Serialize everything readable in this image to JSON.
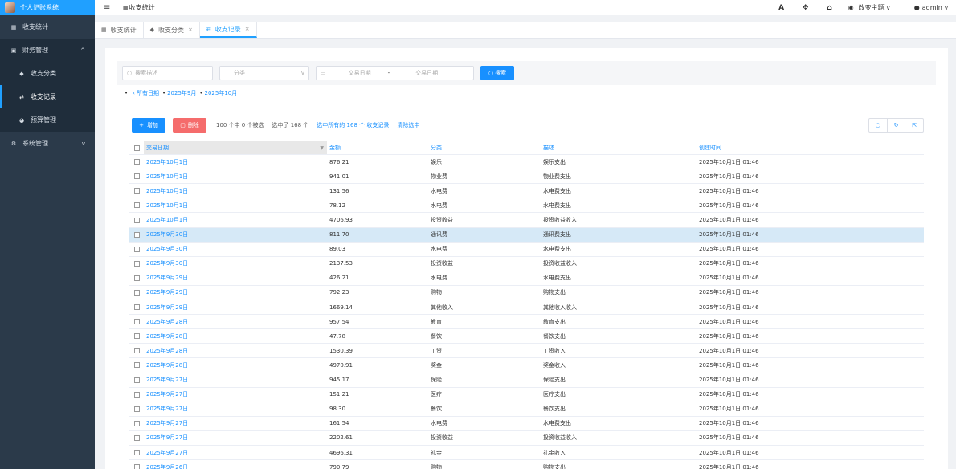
{
  "app": {
    "title": "个人记账系统"
  },
  "sidebar": {
    "items": [
      {
        "label": "收支统计",
        "icon": "grid-icon"
      },
      {
        "label": "财务管理",
        "icon": "wallet-icon",
        "expanded": true
      },
      {
        "label": "收支分类",
        "icon": "tag-icon"
      },
      {
        "label": "收支记录",
        "icon": "exchange-icon",
        "active": true
      },
      {
        "label": "预算管理",
        "icon": "pie-icon"
      },
      {
        "label": "系统管理",
        "icon": "cogs-icon"
      }
    ]
  },
  "header": {
    "breadcrumb": "收支统计",
    "theme_label": "改变主题",
    "user_name": "admin",
    "font_icon_label": "A"
  },
  "tabs": [
    {
      "label": "收支统计"
    },
    {
      "label": "收支分类"
    },
    {
      "label": "收支记录",
      "active": true
    }
  ],
  "filter": {
    "search_placeholder": "搜索描述",
    "category_placeholder": "分类",
    "date_start_placeholder": "交易日期",
    "date_sep": "-",
    "date_end_placeholder": "交易日期",
    "search_button": "搜索"
  },
  "date_crumb": {
    "all": "所有日期",
    "month": "2025年9月",
    "month2": "2025年10月"
  },
  "toolbar": {
    "add_button": "增加",
    "delete_button": "删除",
    "selection_info": "100 个中 0 个被选",
    "selected_count": "选中了 168 个",
    "select_all_link": "选中所有的 168 个 收支记录",
    "clear_link": "清除选中"
  },
  "table": {
    "headers": [
      "交易日期",
      "金额",
      "分类",
      "描述",
      "创建时间"
    ],
    "rows": [
      [
        "2025年10月1日",
        "876.21",
        "娱乐",
        "娱乐支出",
        "2025年10月1日 01:46"
      ],
      [
        "2025年10月1日",
        "941.01",
        "物业费",
        "物业费支出",
        "2025年10月1日 01:46"
      ],
      [
        "2025年10月1日",
        "131.56",
        "水电费",
        "水电费支出",
        "2025年10月1日 01:46"
      ],
      [
        "2025年10月1日",
        "78.12",
        "水电费",
        "水电费支出",
        "2025年10月1日 01:46"
      ],
      [
        "2025年10月1日",
        "4706.93",
        "投资收益",
        "投资收益收入",
        "2025年10月1日 01:46"
      ],
      [
        "2025年9月30日",
        "811.70",
        "通讯费",
        "通讯费支出",
        "2025年10月1日 01:46"
      ],
      [
        "2025年9月30日",
        "89.03",
        "水电费",
        "水电费支出",
        "2025年10月1日 01:46"
      ],
      [
        "2025年9月30日",
        "2137.53",
        "投资收益",
        "投资收益收入",
        "2025年10月1日 01:46"
      ],
      [
        "2025年9月29日",
        "426.21",
        "水电费",
        "水电费支出",
        "2025年10月1日 01:46"
      ],
      [
        "2025年9月29日",
        "792.23",
        "购物",
        "购物支出",
        "2025年10月1日 01:46"
      ],
      [
        "2025年9月29日",
        "1669.14",
        "其他收入",
        "其他收入收入",
        "2025年10月1日 01:46"
      ],
      [
        "2025年9月28日",
        "957.54",
        "教育",
        "教育支出",
        "2025年10月1日 01:46"
      ],
      [
        "2025年9月28日",
        "47.78",
        "餐饮",
        "餐饮支出",
        "2025年10月1日 01:46"
      ],
      [
        "2025年9月28日",
        "1530.39",
        "工资",
        "工资收入",
        "2025年10月1日 01:46"
      ],
      [
        "2025年9月28日",
        "4970.91",
        "奖金",
        "奖金收入",
        "2025年10月1日 01:46"
      ],
      [
        "2025年9月27日",
        "945.17",
        "保险",
        "保险支出",
        "2025年10月1日 01:46"
      ],
      [
        "2025年9月27日",
        "151.21",
        "医疗",
        "医疗支出",
        "2025年10月1日 01:46"
      ],
      [
        "2025年9月27日",
        "98.30",
        "餐饮",
        "餐饮支出",
        "2025年10月1日 01:46"
      ],
      [
        "2025年9月27日",
        "161.54",
        "水电费",
        "水电费支出",
        "2025年10月1日 01:46"
      ],
      [
        "2025年9月27日",
        "2202.61",
        "投资收益",
        "投资收益收入",
        "2025年10月1日 01:46"
      ],
      [
        "2025年9月27日",
        "4696.31",
        "礼金",
        "礼金收入",
        "2025年10月1日 01:46"
      ],
      [
        "2025年9月26日",
        "790.79",
        "购物",
        "购物支出",
        "2025年10月1日 01:46"
      ]
    ],
    "highlighted_row": 5
  },
  "colors": {
    "accent": "#1890ff",
    "sidebar": "#2b3a4a",
    "danger": "#f56c6c",
    "highlight": "#d6e9f7"
  }
}
